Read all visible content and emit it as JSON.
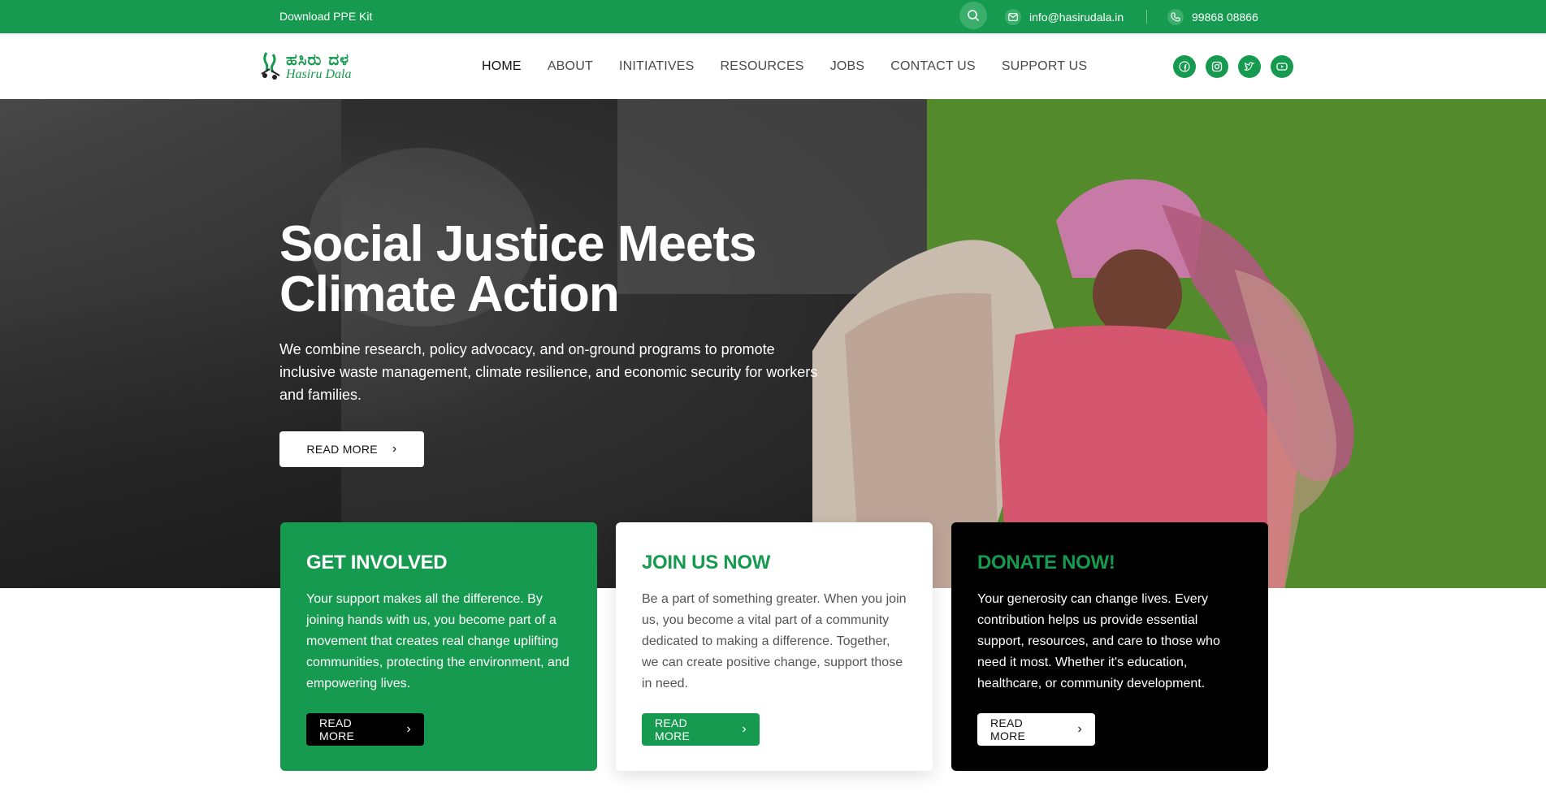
{
  "topbar": {
    "ppe_link": "Download PPE Kit",
    "email": "info@hasirudala.in",
    "phone": "99868 08866"
  },
  "logo": {
    "kannada": "ಹಸಿರು ದಳ",
    "english": "Hasiru Dala"
  },
  "nav": {
    "items": [
      {
        "label": "HOME",
        "active": true
      },
      {
        "label": "ABOUT"
      },
      {
        "label": "INITIATIVES"
      },
      {
        "label": "RESOURCES"
      },
      {
        "label": "JOBS"
      },
      {
        "label": "CONTACT US"
      },
      {
        "label": "SUPPORT US"
      }
    ]
  },
  "socials": [
    "facebook-icon",
    "instagram-icon",
    "twitter-icon",
    "youtube-icon"
  ],
  "hero": {
    "title_line1": "Social Justice Meets",
    "title_line2": "Climate Action",
    "text": "We combine research, policy advocacy, and on-ground programs to promote inclusive waste management, climate resilience, and economic security for workers and families.",
    "button": "READ MORE"
  },
  "cards": [
    {
      "title": "GET INVOLVED",
      "text": "Your support makes all the difference. By joining hands with us, you become part of a movement that creates real change uplifting communities, protecting the environment, and empowering lives.",
      "button": "READ MORE"
    },
    {
      "title": "JOIN US NOW",
      "text": "Be a part of something greater. When you join us, you become a vital part of a community dedicated to making a difference. Together, we can create positive change, support those in need.",
      "button": "READ MORE"
    },
    {
      "title": "DONATE NOW!",
      "text": "Your generosity can change lives. Every contribution helps us provide essential support, resources, and care to those who need it most. Whether it's education, healthcare, or community development.",
      "button": "READ MORE"
    }
  ],
  "colors": {
    "brand_green": "#169a4f",
    "hero_green": "#528a2c",
    "dark": "#000000"
  }
}
